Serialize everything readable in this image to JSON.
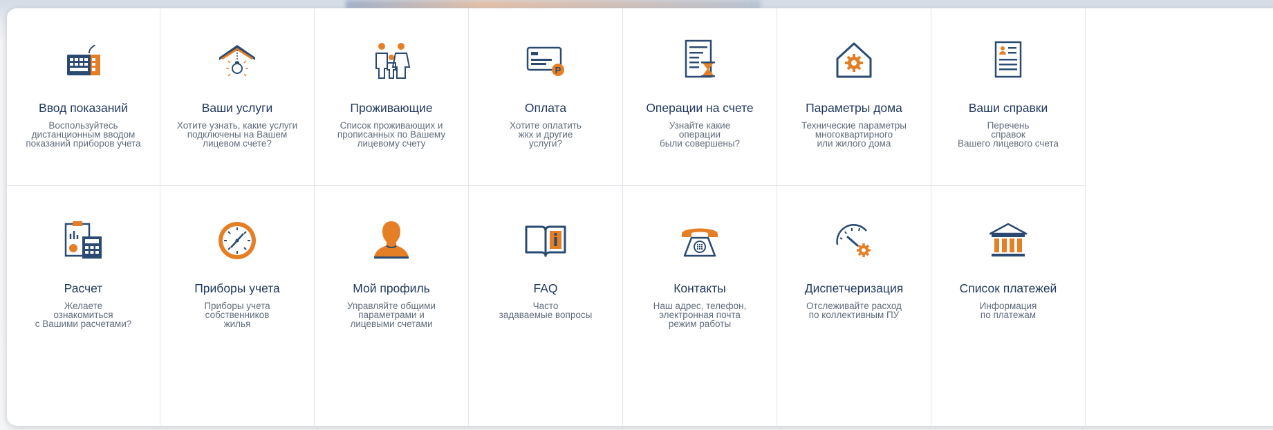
{
  "colors": {
    "navy": "#2a4a72",
    "orange": "#e57f26",
    "title": "#233a5e",
    "text": "#606d7c"
  },
  "tiles": [
    {
      "icon": "keyboard-icon",
      "title": "Ввод показаний",
      "desc": "Воспользуйтесь\nдистанционным вводом\nпоказаний приборов учета"
    },
    {
      "icon": "roof-lightbulb-icon",
      "title": "Ваши услуги",
      "desc": "Хотите узнать, какие услуги\nподключены на Вашем\nлицевом счете?"
    },
    {
      "icon": "family-icon",
      "title": "Проживающие",
      "desc": "Список проживающих и\nпрописанных по Вашему\nлицевому счету"
    },
    {
      "icon": "payment-card-icon",
      "title": "Оплата",
      "desc": "Хотите оплатить\nжкх и другие\nуслуги?"
    },
    {
      "icon": "document-hourglass-icon",
      "title": "Операции на счете",
      "desc": "Узнайте какие\nоперации\nбыли совершены?"
    },
    {
      "icon": "house-gear-icon",
      "title": "Параметры дома",
      "desc": "Технические параметры\nмногоквартирного\nили жилого дома"
    },
    {
      "icon": "id-document-icon",
      "title": "Ваши справки",
      "desc": "Перечень\nсправок\nВашего лицевого счета"
    },
    {
      "icon": "calculator-clipboard-icon",
      "title": "Расчет",
      "desc": "Желаете\nознакомиться\nс Вашими расчетами?"
    },
    {
      "icon": "meter-gauge-icon",
      "title": "Приборы учета",
      "desc": "Приборы учета\nсобственников\nжилья"
    },
    {
      "icon": "user-profile-icon",
      "title": "Мой профиль",
      "desc": "Управляйте общими\nпараметрами и\nлицевыми счетами"
    },
    {
      "icon": "book-info-icon",
      "title": "FAQ",
      "desc": "Часто\nзадаваемые вопросы"
    },
    {
      "icon": "telephone-icon",
      "title": "Контакты",
      "desc": "Наш адрес, телефон,\nэлектронная почта\nрежим работы"
    },
    {
      "icon": "speedometer-gear-icon",
      "title": "Диспетчеризация",
      "desc": "Отслеживайте расход\nпо коллективным ПУ"
    },
    {
      "icon": "bank-building-icon",
      "title": "Список платежей",
      "desc": "Информация\nпо платежам"
    }
  ]
}
